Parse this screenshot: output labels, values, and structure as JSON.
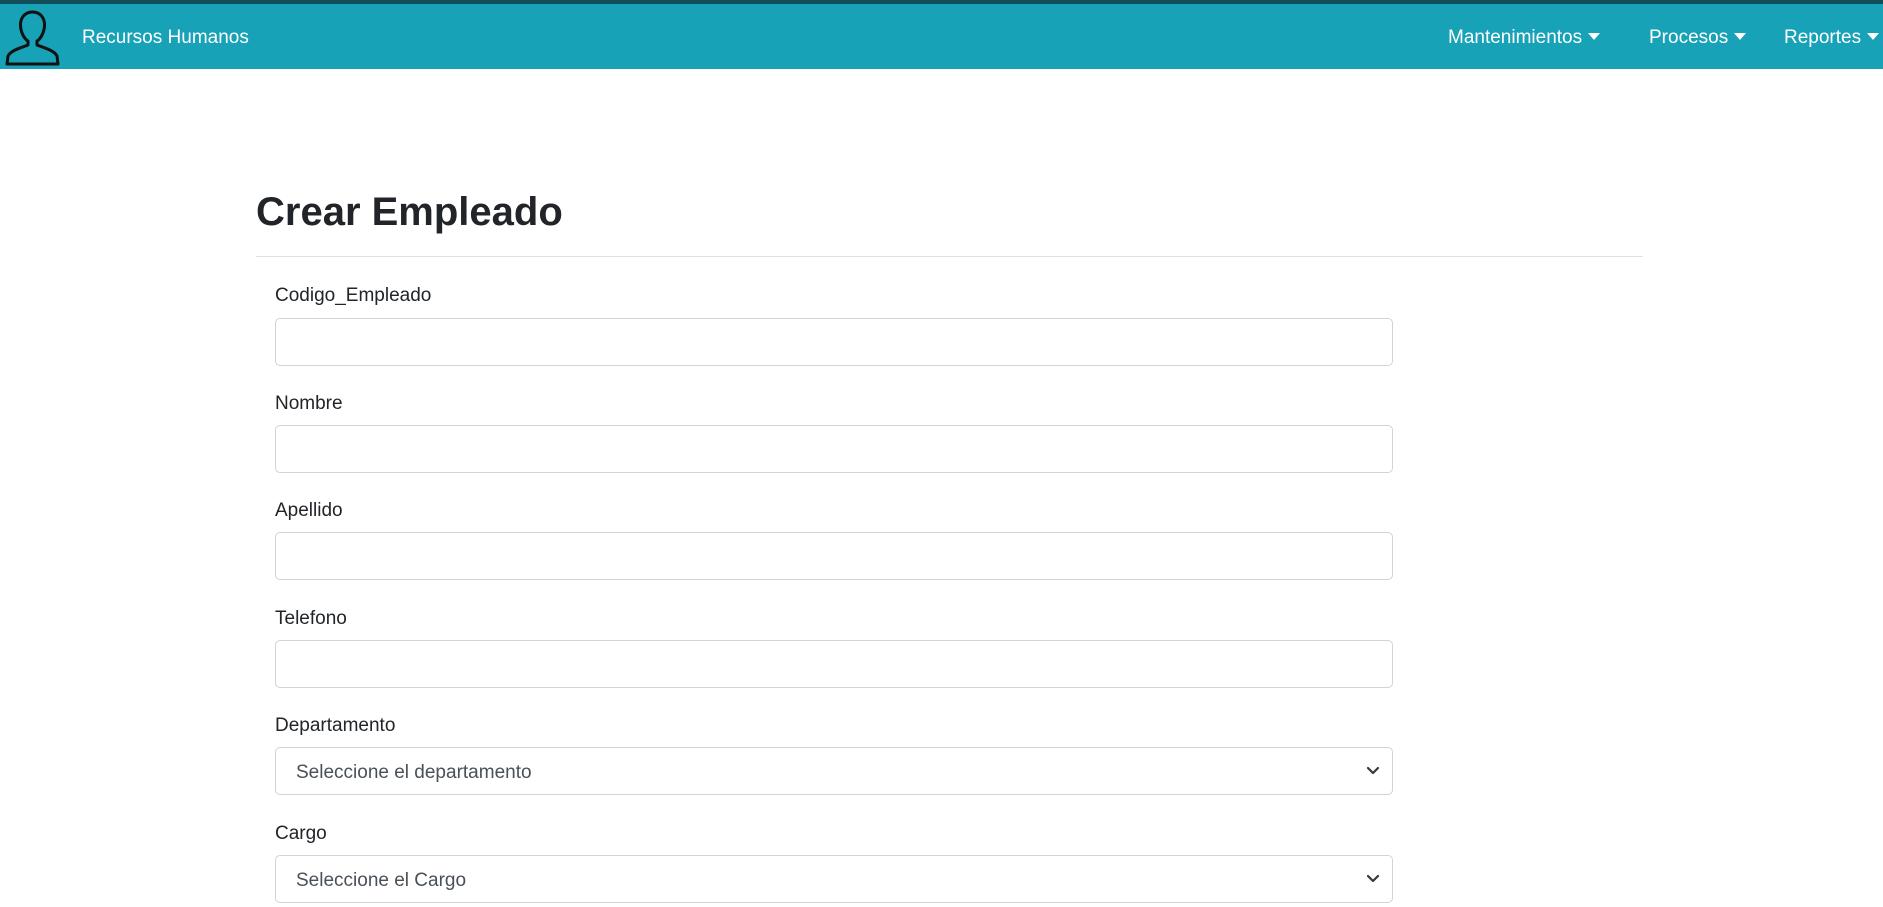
{
  "navbar": {
    "brand": "Recursos Humanos",
    "brand_icon": "user-silhouette-icon",
    "background_color": "#17a2b8",
    "menus": [
      {
        "label": "Mantenimientos"
      },
      {
        "label": "Procesos"
      },
      {
        "label": "Reportes"
      }
    ]
  },
  "page": {
    "title": "Crear Empleado"
  },
  "form": {
    "codigo": {
      "label": "Codigo_Empleado",
      "value": ""
    },
    "nombre": {
      "label": "Nombre",
      "value": ""
    },
    "apellido": {
      "label": "Apellido",
      "value": ""
    },
    "telefono": {
      "label": "Telefono",
      "value": ""
    },
    "departamento": {
      "label": "Departamento",
      "selected": "Seleccione el departamento"
    },
    "cargo": {
      "label": "Cargo",
      "selected": "Seleccione el Cargo"
    }
  }
}
